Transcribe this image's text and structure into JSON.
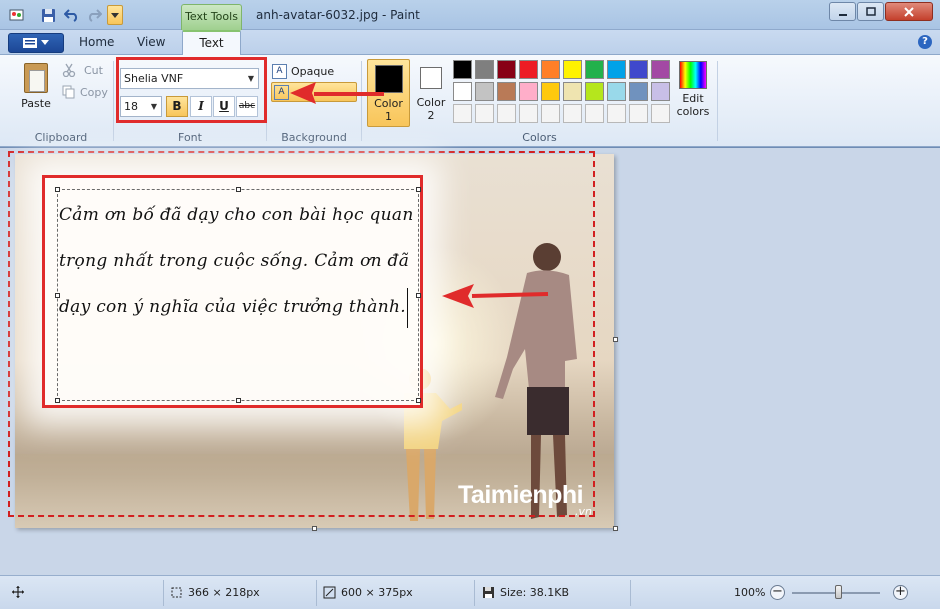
{
  "window": {
    "title": "anh-avatar-6032.jpg - Paint",
    "context_tab": "Text Tools"
  },
  "tabs": [
    "Home",
    "View",
    "Text"
  ],
  "clipboard": {
    "paste": "Paste",
    "cut": "Cut",
    "copy": "Copy",
    "group": "Clipboard"
  },
  "font": {
    "family": "Shelia VNF",
    "size": "18",
    "bold": "B",
    "italic": "I",
    "underline": "U",
    "strike": "abc",
    "group": "Font"
  },
  "background": {
    "opaque": "Opaque",
    "group": "Background"
  },
  "colors": {
    "color1_label": "Color\n1",
    "color1_a": "Color",
    "color1_b": "1",
    "color2_a": "Color",
    "color2_b": "2",
    "color1_value": "#000000",
    "color2_value": "#ffffff",
    "edit_a": "Edit",
    "edit_b": "colors",
    "group": "Colors",
    "palette_row1": [
      "#000000",
      "#7f7f7f",
      "#880015",
      "#ed1c24",
      "#ff7f27",
      "#fff200",
      "#22b14c",
      "#00a2e8",
      "#3f48cc",
      "#a349a4"
    ],
    "palette_row2": [
      "#ffffff",
      "#c3c3c3",
      "#b97a57",
      "#ffaec9",
      "#ffc90e",
      "#efe4b0",
      "#b5e61d",
      "#99d9ea",
      "#7092be",
      "#c8bfe7"
    ]
  },
  "text_box": {
    "line1": "Cảm ơn bố đã dạy cho con bài học quan",
    "line2": "trọng nhất trong cuộc sống. Cảm ơn đã",
    "line3": "dạy con ý nghĩa của việc trưởng thành."
  },
  "watermark": {
    "main": "Taimienphi",
    "sub": ".vn"
  },
  "status": {
    "selection": "366 × 218px",
    "image_size": "600 × 375px",
    "file_size": "Size: 38.1KB",
    "zoom": "100%"
  }
}
